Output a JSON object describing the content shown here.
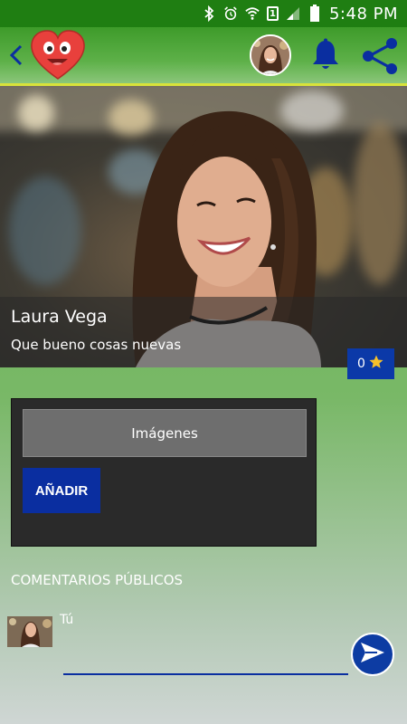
{
  "status_bar": {
    "time": "5:48 PM",
    "icons": [
      "bluetooth-icon",
      "alarm-icon",
      "wifi-icon",
      "sim-icon",
      "signal-icon",
      "battery-icon"
    ],
    "sim_label": "1"
  },
  "app_bar": {
    "icons": [
      "back-icon",
      "heart-logo",
      "profile-avatar",
      "bell-icon",
      "share-icon"
    ],
    "accent_color": "#1f7e12"
  },
  "profile": {
    "name": "Laura Vega",
    "status": "Que bueno cosas nuevas",
    "rating": "0"
  },
  "images_section": {
    "header": "Imágenes",
    "add_button": "AÑADIR"
  },
  "comments": {
    "title": "COMENTARIOS PÚBLICOS",
    "current_user": "Tú",
    "input_value": "",
    "send_icon": "send-icon"
  },
  "colors": {
    "primary_blue": "#0a2ea0",
    "heart_red": "#e8403c"
  }
}
